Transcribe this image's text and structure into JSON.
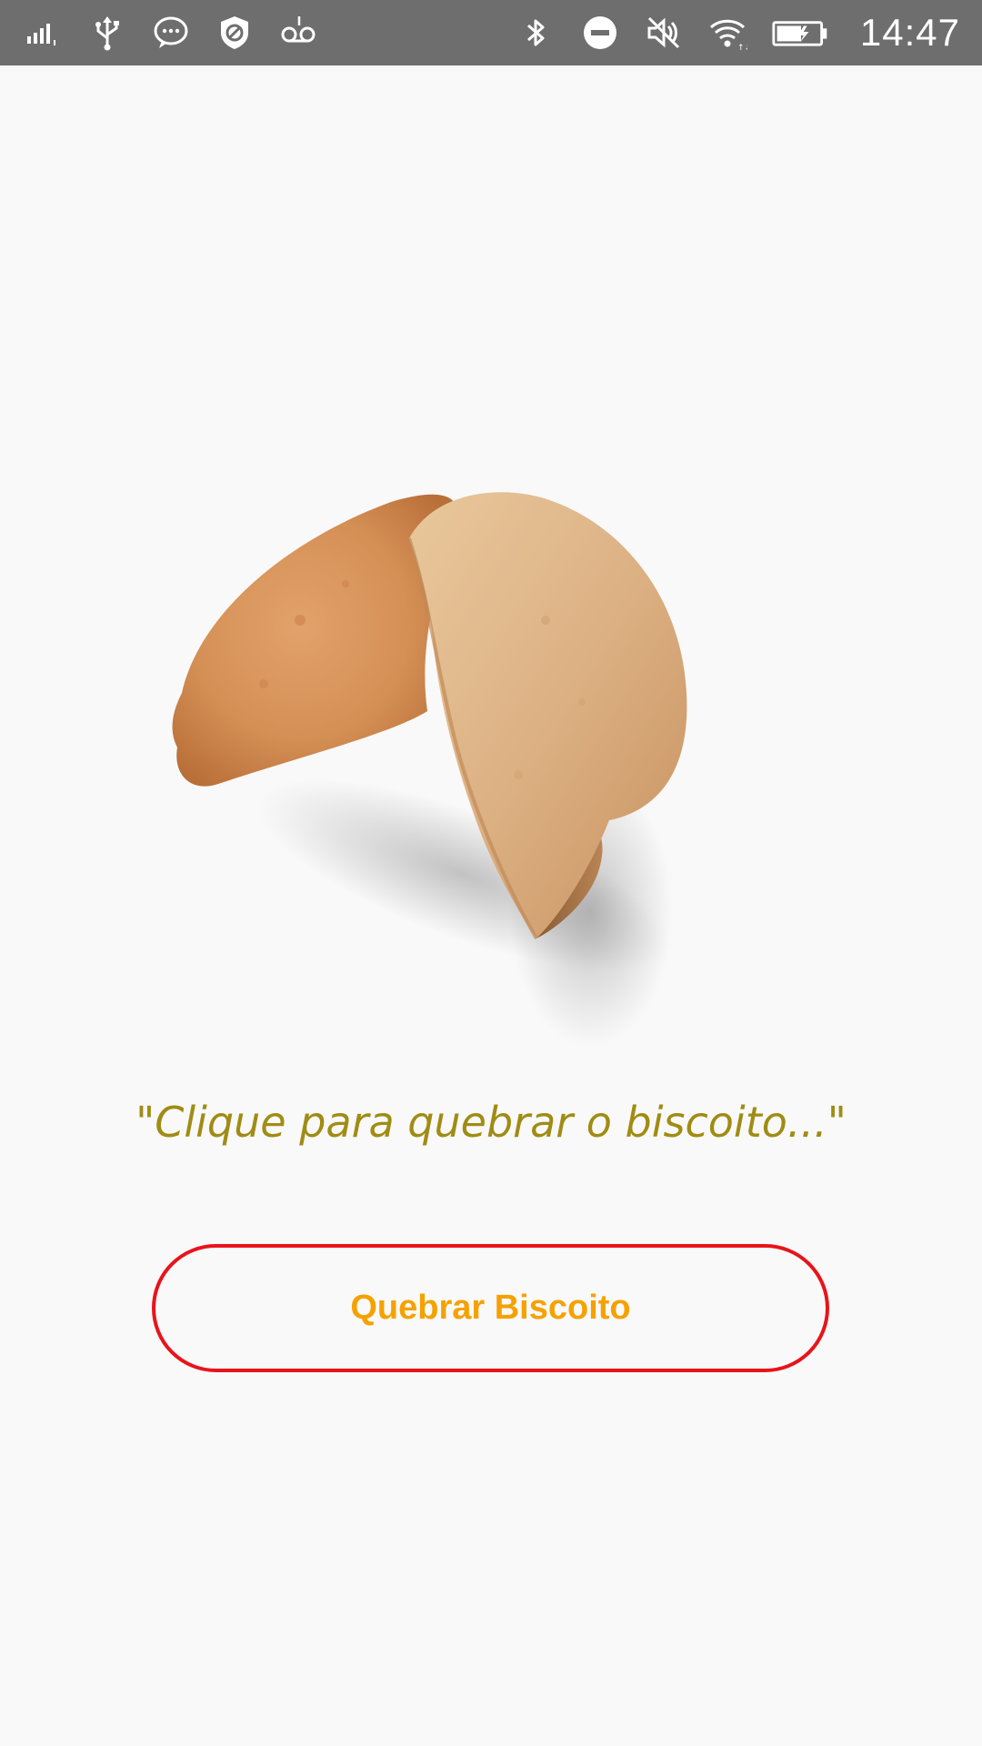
{
  "status_bar": {
    "time": "14:47",
    "left_icons": [
      "signal-icon",
      "usb-icon",
      "message-icon",
      "shield-icon",
      "voicemail-icon"
    ],
    "right_icons": [
      "bluetooth-icon",
      "do-not-disturb-icon",
      "vibrate-off-icon",
      "wifi-icon",
      "battery-icon"
    ]
  },
  "main": {
    "image": "fortune-cookie",
    "prompt_text": "\"Clique para quebrar o biscoito...\"",
    "button_label": "Quebrar Biscoito"
  },
  "colors": {
    "background": "#f9f9f9",
    "status_bar": "#6e6e6e",
    "prompt_text": "#a08c14",
    "button_border": "#e8141b",
    "button_text": "#f5a100"
  }
}
